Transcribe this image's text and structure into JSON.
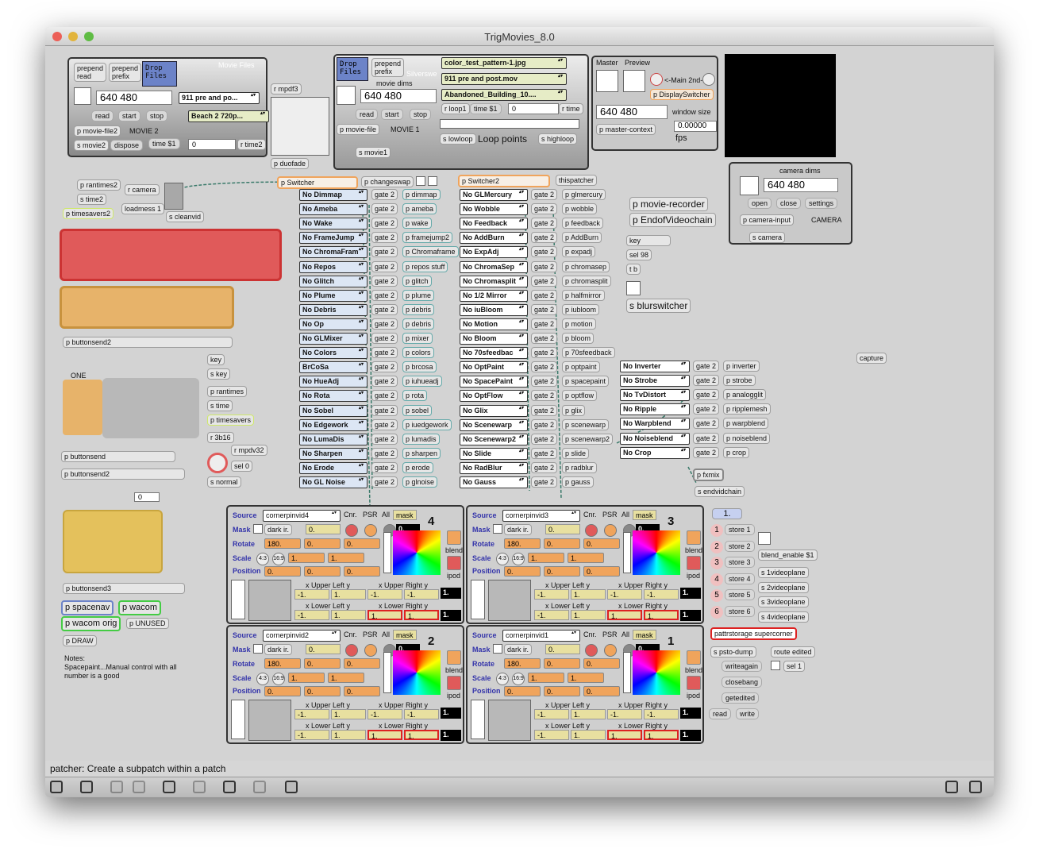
{
  "window": {
    "title": "TrigMovies_8.0"
  },
  "status": {
    "text": "patcher: Create a subpatch within a patch"
  },
  "movie2": {
    "prepend_read": "prepend\nread",
    "prepend_prefix": "prepend\nprefix",
    "drop": "Drop\nFiles",
    "heading": "Movie Files",
    "dims": "640 480",
    "menu1": "911 pre and po...",
    "menu2": "Beach 2 720p...",
    "read": "read",
    "start": "start",
    "stop": "stop",
    "pfile": "p movie-file2",
    "label": "MOVIE 2",
    "smovie": "s movie2",
    "dispose": "dispose",
    "time": "time $1",
    "zero": "0",
    "rtime": "r time2",
    "rmpdf": "r mpdf3",
    "duofade": "p duofade"
  },
  "movie1": {
    "drop": "Drop\nFiles",
    "prepend": "prepend\nprefix",
    "silverswe": "Silverswe",
    "dims_label": "movie dims",
    "dims": "640 480",
    "menu_a": "color_test_pattern-1.jpg",
    "menu_b": "911 pre and post.mov",
    "menu_c": "Abandoned_Building_10....",
    "rloop": "r loop1",
    "time": "time $1",
    "zero": "0",
    "rtime": "r time",
    "read": "read",
    "start": "start",
    "stop": "stop",
    "pfile": "p movie-file",
    "label": "MOVIE 1",
    "smovie": "s movie1",
    "lowloop": "s lowloop",
    "looppoints": "Loop points",
    "highloop": "s highloop"
  },
  "master": {
    "title": "Master",
    "preview": "Preview",
    "main": "<-Main 2nd->",
    "display": "p DisplaySwitcher",
    "dims": "640 480",
    "winsize": "window size",
    "context": "p master-context",
    "fps_val": "0.00000",
    "fps": "fps"
  },
  "camera": {
    "title": "camera dims",
    "dims": "640 480",
    "open": "open",
    "close": "close",
    "settings": "settings",
    "input": "p camera-input",
    "label": "CAMERA",
    "scam": "s camera"
  },
  "misc": {
    "rantimes2": "p rantimes2",
    "time2": "s time2",
    "rcamera": "r camera",
    "loadmess": "loadmess 1",
    "timesavers2": "p timesavers2",
    "cleanvid": "s cleanvid",
    "switcher": "p Switcher",
    "changeswap": "p changeswap",
    "switcher2": "p Switcher2",
    "thispatcher": "thispatcher",
    "recorder": "p movie-recorder",
    "endof": "p EndofVideochain",
    "key": "key",
    "sel98": "sel 98",
    "tb": "t b",
    "blur": "s blurswitcher",
    "capture": "capture",
    "buttonsend2a": "p buttonsend2",
    "one": "ONE",
    "keyr": "key",
    "skey": "s key",
    "prantimes": "p rantimes",
    "stime": "s time",
    "ptimesavers": "p timesavers",
    "r3b16": "r 3b16",
    "rmpdv": "r mpdv32",
    "sel0": "sel 0",
    "snormal": "s normal",
    "buttonsend": "p buttonsend",
    "buttonsend2b": "p buttonsend2",
    "zero": "0",
    "buttonsend3": "p buttonsend3",
    "spacenav": "p spacenav",
    "wacom": "p wacom",
    "wacomorig": "p wacom orig",
    "unused": "p UNUSED",
    "draw": "p DRAW",
    "notes": "Notes:\nSpacepaint...Manual control with all\nnumber is a good",
    "fxmix": "p fxmix",
    "endvid": "s endvidchain"
  },
  "colA": [
    "No Dimmap",
    "No Ameba",
    "No Wake",
    "No FrameJump",
    "No ChromaFram",
    "No Repos",
    "No Glitch",
    "No Plume",
    "No Debris",
    "No Op",
    "No GLMixer",
    "No Colors",
    "BrCoSa",
    "No HueAdj",
    "No Rota",
    "No Sobel",
    "No Edgework",
    "No LumaDis",
    "No Sharpen",
    "No Erode",
    "No GL Noise"
  ],
  "colAp": [
    "p dimmap",
    "p ameba",
    "p wake",
    "p framejump2",
    "p Chromaframe",
    "p repos stuff",
    "p glitch",
    "p plume",
    "p debris",
    "p debris",
    "p mixer",
    "p colors",
    "p brcosa",
    "p iuhueadj",
    "p rota",
    "p sobel",
    "p iuedgework",
    "p lumadis",
    "p sharpen",
    "p erode",
    "p glnoise"
  ],
  "colB": [
    "No GLMercury",
    "No Wobble",
    "No Feedback",
    "No AddBurn",
    "No ExpAdj",
    "No ChromaSep",
    "No Chromasplit",
    "No 1/2 Mirror",
    "No iuBloom",
    "No Motion",
    "No Bloom",
    "No 70sfeedbac",
    "No OptPaint",
    "No SpacePaint",
    "No OptFlow",
    "No Glix",
    "No Scenewarp",
    "No Scenewarp2",
    "No Slide",
    "No RadBlur",
    "No Gauss"
  ],
  "colBp": [
    "p glmercury",
    "p wobble",
    "p feedback",
    "p AddBurn",
    "p expadj",
    "p chromasep",
    "p chromasplit",
    "p halfmirror",
    "p iubloom",
    "p motion",
    "p bloom",
    "p 70sfeedback",
    "p optpaint",
    "p spacepaint",
    "p optflow",
    "p glix",
    "p scenewarp",
    "p scenewarp2",
    "p slide",
    "p radblur",
    "p gauss"
  ],
  "colC": [
    "No Inverter",
    "No Strobe",
    "No TvDistort",
    "No Ripple",
    "No Warpblend",
    "No Noiseblend",
    "No Crop"
  ],
  "colCp": [
    "p inverter",
    "p strobe",
    "p analogglit",
    "p ripplemesh",
    "p warpblend",
    "p noiseblend",
    "p crop"
  ],
  "gate": "gate 2",
  "corner": [
    {
      "src": "cornerpinvid4",
      "num": "4"
    },
    {
      "src": "cornerpinvid3",
      "num": "3"
    },
    {
      "src": "cornerpinvid2",
      "num": "2"
    },
    {
      "src": "cornerpinvid1",
      "num": "1"
    }
  ],
  "cp": {
    "source": "Source",
    "mask": "Mask",
    "rotate": "Rotate",
    "scale": "Scale",
    "position": "Position",
    "darkir": "dark ir.",
    "cnr": "Cnr.",
    "psr": "PSR",
    "all": "All",
    "maskbtn": "mask",
    "zero": "0.",
    "zero2": "0.",
    "v180": "180.",
    "r43": "4:3",
    "r169": "16:9",
    "one": "1.",
    "ul": "x Upper Left y",
    "ur": "x Upper Right y",
    "ll": "x Lower Left y",
    "lr": "x Lower Right y",
    "m1": "-1.",
    "p1": "1.",
    "blend": "blend",
    "ipod": "ipod"
  },
  "store": {
    "top": "1.",
    "items": [
      "store 1",
      "store 2",
      "store 3",
      "store 4",
      "store 5",
      "store 6"
    ],
    "nums": [
      "1",
      "2",
      "3",
      "4",
      "5",
      "6"
    ],
    "blend": "blend_enable $1",
    "vp": [
      "s 1videoplane",
      "s 2videoplane",
      "s 3videoplane",
      "s 4videoplane"
    ],
    "pattr": "pattrstorage supercorner",
    "psto": "s psto-dump",
    "route": "route edited",
    "write": "writeagain",
    "sel1": "sel 1",
    "close": "closebang",
    "getedited": "getedited",
    "read": "read",
    "writeb": "write"
  }
}
